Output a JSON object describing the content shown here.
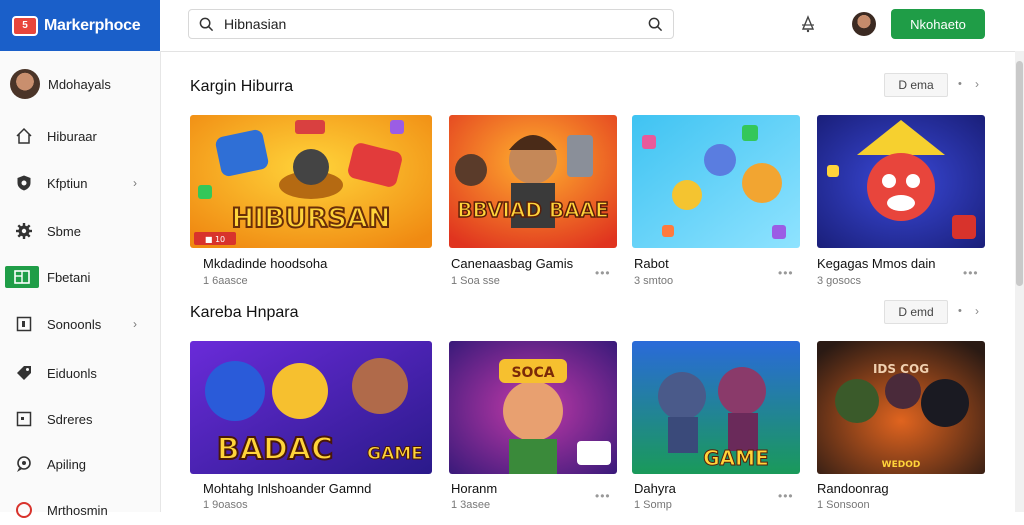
{
  "app": {
    "name": "Markerphoce",
    "logo_text": "5"
  },
  "search": {
    "value": "Hibnasian"
  },
  "header": {
    "cta_label": "Nkohaeto"
  },
  "sidebar": {
    "user_name": "Mdohayals",
    "items": [
      {
        "label": "Hiburaar",
        "icon": "home-icon"
      },
      {
        "label": "Kfptiun",
        "icon": "shield-icon"
      },
      {
        "label": "Sbme",
        "icon": "gear-icon"
      },
      {
        "label": "Fbetani",
        "icon": "store-icon"
      },
      {
        "label": "Sonoonls",
        "icon": "grid-icon"
      },
      {
        "label": "Eiduonls",
        "icon": "tag-icon"
      },
      {
        "label": "Sdreres",
        "icon": "square-icon"
      },
      {
        "label": "Apiling",
        "icon": "chat-icon"
      },
      {
        "label": "Mrthosmin",
        "icon": "circle-icon"
      }
    ]
  },
  "sections": [
    {
      "title": "Kargin Hiburra",
      "button": "D ema",
      "dot": "•",
      "next": "›",
      "cards": [
        {
          "title": "Mkdadinde hoodsoha",
          "meta": "1 6aasce",
          "thumb_text": "HIBURSAN",
          "badge": "■ 10"
        },
        {
          "title": "Canenaasbag Gamis",
          "meta": "1 Soa sse",
          "thumb_text": "BBVIAD BAAE",
          "more": "•••"
        },
        {
          "title": "Rabot",
          "meta": "3 smtoo",
          "more": "•••"
        },
        {
          "title": "Kegagas Mmos dain",
          "meta": "3 gosocs",
          "more": "•••"
        }
      ]
    },
    {
      "title": "Kareba Hnpara",
      "button": "D emd",
      "dot": "•",
      "next": "›",
      "cards": [
        {
          "title": "Mohtahg Inlshoander Gamnd",
          "meta": "1 9oasos",
          "thumb_text": "BADAC",
          "thumb_text2": "GAME",
          "more": "•••"
        },
        {
          "title": "Horanm",
          "meta": "1 3asee",
          "thumb_text": "SOCA",
          "more": "•••"
        },
        {
          "title": "Dahyra",
          "meta": "1 Somp",
          "thumb_text": "GAME",
          "more": "•••"
        },
        {
          "title": "Randoonrag",
          "meta": "1 Sonsoon",
          "thumb_text": "IDS COG",
          "thumb_text2": "WEDOD",
          "more": "•••"
        }
      ]
    }
  ],
  "colors": {
    "brand": "#1a5fc9",
    "cta": "#1f9d47",
    "logo": "#e8463c"
  }
}
